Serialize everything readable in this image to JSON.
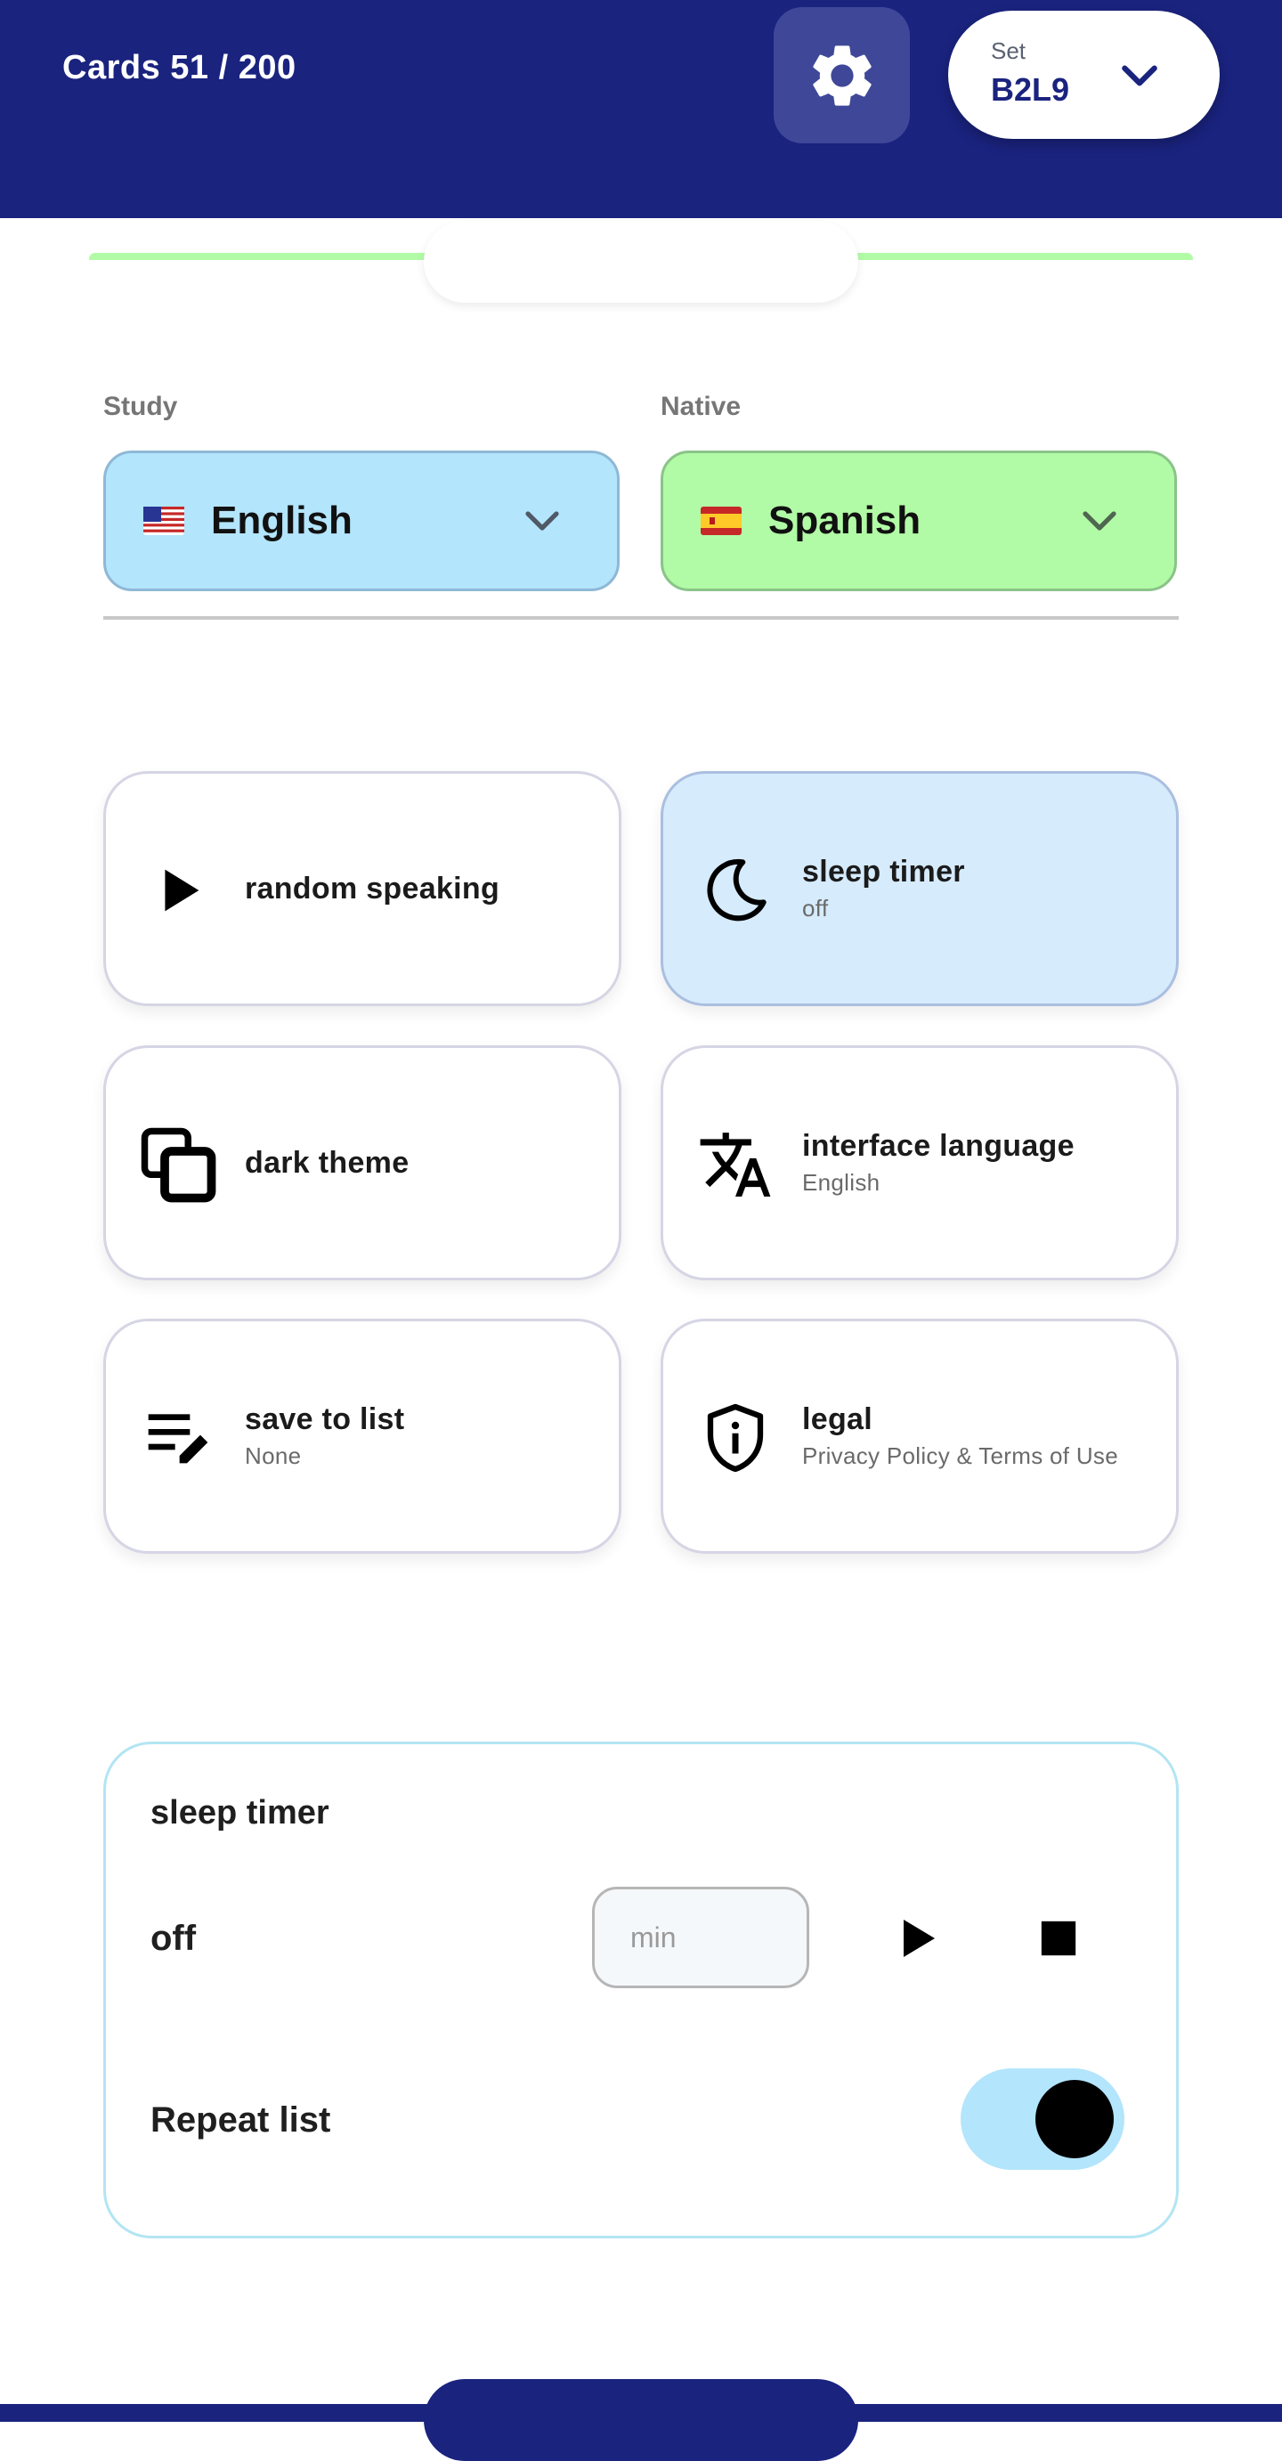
{
  "header": {
    "cards_count": "Cards 51 / 200",
    "set_label": "Set",
    "set_value": "B2L9",
    "settings_icon": "gear-icon"
  },
  "languages": {
    "study": {
      "label": "Study",
      "value": "English",
      "flag": "us-flag"
    },
    "native": {
      "label": "Native",
      "value": "Spanish",
      "flag": "es-flag"
    }
  },
  "tiles": [
    {
      "title": "random speaking",
      "subtitle": "",
      "icon": "play-icon",
      "active": false
    },
    {
      "title": "sleep timer",
      "subtitle": "off",
      "icon": "moon-icon",
      "active": true
    },
    {
      "title": "dark theme",
      "subtitle": "",
      "icon": "theme-squares-icon",
      "active": false
    },
    {
      "title": "interface language",
      "subtitle": "English",
      "icon": "translate-icon",
      "active": false
    },
    {
      "title": "save to list",
      "subtitle": "None",
      "icon": "playlist-edit-icon",
      "active": false
    },
    {
      "title": "legal",
      "subtitle": "Privacy Policy & Terms of Use",
      "icon": "shield-info-icon",
      "active": false
    }
  ],
  "sleep_timer": {
    "title": "sleep timer",
    "state": "off",
    "minutes_value": "",
    "minutes_placeholder": "min",
    "repeat_label": "Repeat list",
    "repeat_on": true
  },
  "colors": {
    "primary": "#1a237e",
    "study_bg": "#b3e5fc",
    "native_bg": "#b2fba6",
    "active_tile_bg": "#d6ebfc"
  }
}
